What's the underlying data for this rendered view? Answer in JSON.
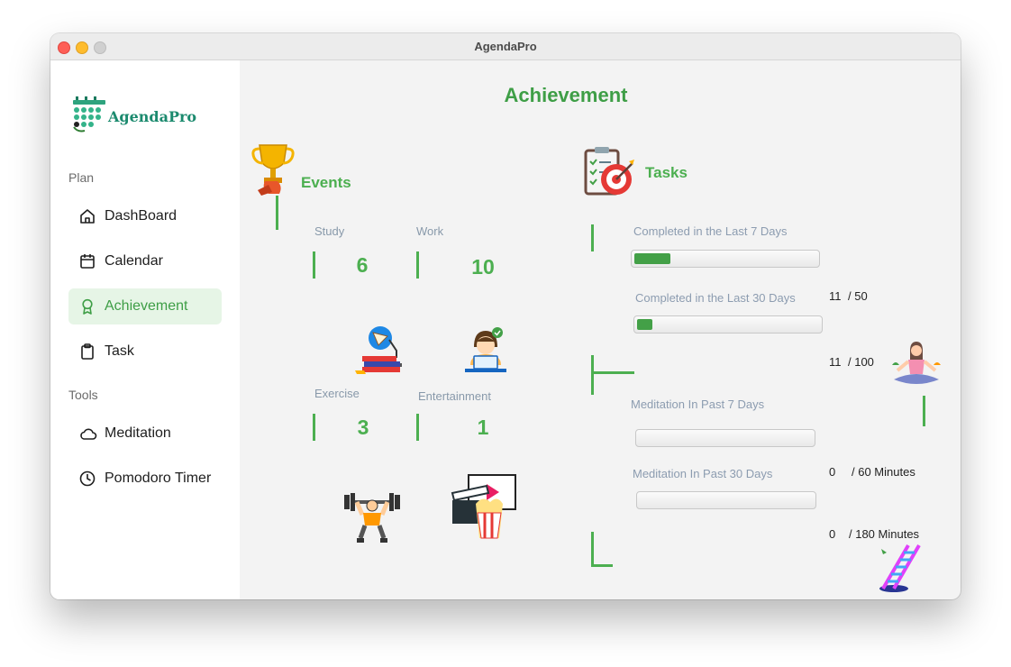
{
  "window": {
    "title": "AgendaPro"
  },
  "sidebar": {
    "logo_text": "AgendaPro",
    "sections": [
      {
        "label": "Plan"
      },
      {
        "label": "Tools"
      }
    ],
    "items": [
      {
        "label": "DashBoard",
        "icon": "home-icon"
      },
      {
        "label": "Calendar",
        "icon": "calendar-icon"
      },
      {
        "label": "Achievement",
        "icon": "award-icon",
        "active": true
      },
      {
        "label": "Task",
        "icon": "clipboard-icon"
      },
      {
        "label": "Meditation",
        "icon": "cloud-icon"
      },
      {
        "label": "Pomodoro Timer",
        "icon": "clock-icon"
      }
    ]
  },
  "main": {
    "title": "Achievement",
    "events": {
      "heading": "Events",
      "categories": [
        {
          "label": "Study",
          "count": "6",
          "icon": "study-desk-icon"
        },
        {
          "label": "Work",
          "count": "10",
          "icon": "laptop-worker-icon"
        },
        {
          "label": "Exercise",
          "count": "3",
          "icon": "weightlifter-icon"
        },
        {
          "label": "Entertainment",
          "count": "1",
          "icon": "movie-popcorn-icon"
        }
      ]
    },
    "tasks": {
      "heading": "Tasks",
      "progress": [
        {
          "label": "Completed in the Last 7 Days",
          "value": "11",
          "total": "/ 50",
          "fraction": 0.22
        },
        {
          "label": "Completed in the Last 30 Days",
          "value": "11",
          "total": "/ 100",
          "fraction": 0.11
        },
        {
          "label": "Meditation In Past 7 Days",
          "value": "0",
          "total": "/ 60 Minutes",
          "fraction": 0
        },
        {
          "label": "Meditation In Past 30 Days",
          "value": "0",
          "total": "/ 180 Minutes",
          "fraction": 0
        }
      ]
    }
  },
  "colors": {
    "accent": "#4caf50",
    "active_bg": "#e6f5e6",
    "brand": "#1b8a6e"
  }
}
